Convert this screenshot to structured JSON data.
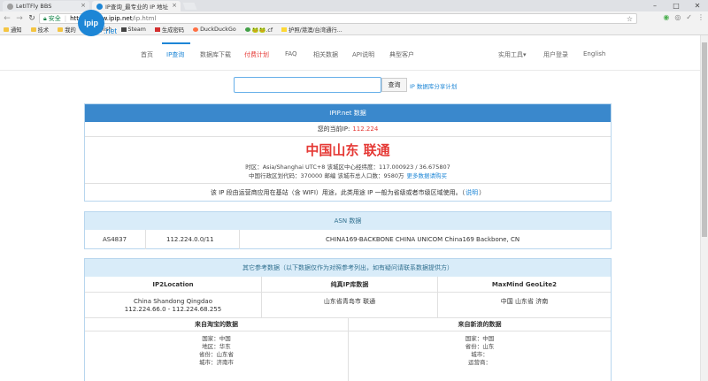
{
  "browser": {
    "tabs": [
      {
        "title": "LetITFly BBS",
        "color": "#9e9e9e"
      },
      {
        "title": "IP查询_最专业的 IP 地址",
        "color": "#1d86d6"
      }
    ],
    "window_controls": [
      "–",
      "□",
      "✕"
    ],
    "omnibox": {
      "secure_label": "安全",
      "host": "https://www.ipip.net",
      "path": "/ip.html"
    },
    "bookmarks": [
      {
        "label": "通知",
        "kind": "folder"
      },
      {
        "label": "技术",
        "kind": "folder"
      },
      {
        "label": "我的",
        "kind": "folder"
      },
      {
        "label": "English",
        "kind": "folder"
      },
      {
        "label": "Steam",
        "kind": "dark"
      },
      {
        "label": "生成密码",
        "kind": "red"
      },
      {
        "label": "DuckDuckGo",
        "kind": "orange"
      },
      {
        "label": "🐸🐸.cf",
        "kind": "green"
      },
      {
        "label": "护照/港澳/台湾通行...",
        "kind": "yellow"
      }
    ]
  },
  "site": {
    "logo_text": "ipip",
    "logo_sub": ".net",
    "nav": [
      {
        "label": "首页",
        "state": "normal"
      },
      {
        "label": "IP查询",
        "state": "active"
      },
      {
        "label": "数据库下载",
        "state": "normal"
      },
      {
        "label": "付费计划",
        "state": "hot"
      },
      {
        "label": "FAQ",
        "state": "normal"
      },
      {
        "label": "相关数据",
        "state": "normal"
      },
      {
        "label": "API说明",
        "state": "normal"
      },
      {
        "label": "典型客户",
        "state": "normal"
      }
    ],
    "nav_right": [
      {
        "label": "实用工具▾"
      },
      {
        "label": "用户登录"
      },
      {
        "label": "English"
      }
    ]
  },
  "search": {
    "value": "",
    "button": "查询",
    "link": "IP 数据库分享计划"
  },
  "ipip_panel": {
    "title": "IPIP.net 数据",
    "ip_label": "您的当前IP:",
    "ip_value": "112.224",
    "location": "中国山东 联通",
    "detail1": "时区：Asia/Shanghai UTC+8 该城区中心经纬度：117.000923 / 36.675807",
    "detail2": "中国行政区划代码：370000 邮编 该城市总人口数：9580万",
    "detail2_link": "更多数据请购买",
    "note_pre": "该 IP 段由运营商应用在基站（含 WIFI）用途，此类用途 IP 一般为省级或者市级区域使用。（",
    "note_link": "说明",
    "note_post": "）"
  },
  "asn_panel": {
    "title": "ASN 数据",
    "asn": "AS4837",
    "prefix": "112.224.0.0/11",
    "name": "CHINA169-BACKBONE CHINA UNICOM China169 Backbone, CN"
  },
  "other_panel": {
    "title": "其它参考数据（以下数据仅作为对照参考列出，如有疑问请联系数据提供方）",
    "cols": [
      {
        "head": "IP2Location",
        "line1": "China Shandong Qingdao",
        "line2": "112.224.66.0 - 112.224.68.255"
      },
      {
        "head": "纯真IP库数据",
        "line1": "山东省青岛市 联通",
        "line2": ""
      },
      {
        "head": "MaxMind GeoLite2",
        "line1": "中国 山东省 济南",
        "line2": ""
      }
    ],
    "taobao": {
      "head": "来自淘宝的数据",
      "lines": [
        "国家：中国",
        "地区：华东",
        "省份：山东省",
        "城市：济南市"
      ]
    },
    "sina": {
      "head": "来自新浪的数据",
      "lines": [
        "国家：中国",
        "省份：山东",
        "城市：",
        "运营商："
      ]
    }
  }
}
